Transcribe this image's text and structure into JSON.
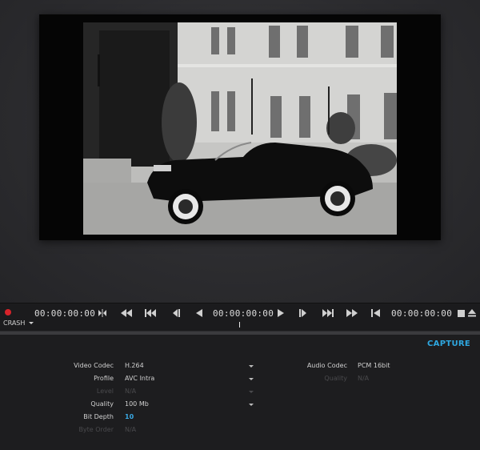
{
  "transport": {
    "timecode_left": "00:00:00:00",
    "timecode_center": "00:00:00:00",
    "timecode_right": "00:00:00:00",
    "device": "CRASH",
    "record_color": "#d8232a"
  },
  "settings": {
    "capture_label": "CAPTURE",
    "video_codec_label": "Video Codec",
    "video_codec_value": "H.264",
    "profile_label": "Profile",
    "profile_value": "AVC Intra",
    "level_label": "Level",
    "level_value": "N/A",
    "quality_label": "Quality",
    "quality_value": "100 Mb",
    "bit_depth_label": "Bit Depth",
    "bit_depth_value": "10",
    "byte_order_label": "Byte Order",
    "byte_order_value": "N/A",
    "audio_codec_label": "Audio Codec",
    "audio_codec_value": "PCM 16bit",
    "audio_quality_label": "Quality",
    "audio_quality_value": "N/A",
    "accent_color": "#2ea7e0"
  }
}
